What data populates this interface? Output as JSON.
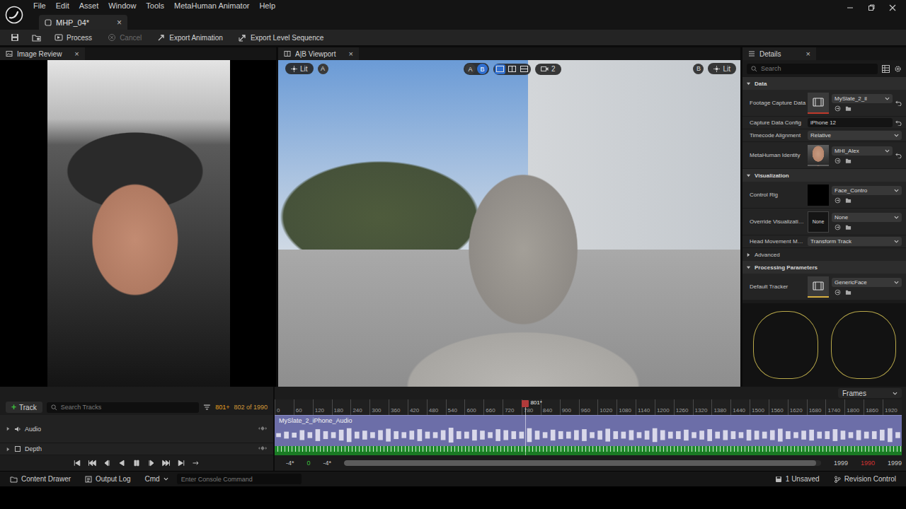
{
  "window": {
    "document_tab": "MHP_04*",
    "tab_close": "×"
  },
  "menu": [
    "File",
    "Edit",
    "Asset",
    "Window",
    "Tools",
    "MetaHuman Animator",
    "Help"
  ],
  "toolbar": [
    {
      "label": "Process",
      "disabled": false
    },
    {
      "label": "Cancel",
      "disabled": true
    },
    {
      "label": "Export Animation",
      "disabled": false
    },
    {
      "label": "Export Level Sequence",
      "disabled": false
    }
  ],
  "image_review": {
    "title": "Image Review",
    "close": "×"
  },
  "viewport": {
    "title": "A|B Viewport",
    "close": "×",
    "left_lit": "Lit",
    "left_view": "A",
    "ab_toggle": [
      {
        "label": "A",
        "selected": false
      },
      {
        "label": "B",
        "selected": true
      }
    ],
    "layouts": [
      {
        "selected": true
      },
      {
        "selected": false
      },
      {
        "selected": false
      }
    ],
    "camera_count": "2",
    "right_view": "B",
    "right_lit": "Lit"
  },
  "details": {
    "title": "Details",
    "close": "×",
    "search_placeholder": "Search",
    "sections": [
      {
        "title": "Data",
        "expanded": true,
        "rows": [
          {
            "label": "Footage Capture Data",
            "kind": "asset",
            "value": "MySlate_2_il",
            "reset": true
          },
          {
            "label": "Capture Data Config",
            "kind": "text",
            "value": "iPhone 12",
            "reset": true
          },
          {
            "label": "Timecode Alignment",
            "kind": "dropdown",
            "value": "Relative",
            "reset": false
          },
          {
            "label": "MetaHuman Identity",
            "kind": "asset",
            "value": "MHI_Alex",
            "reset": true
          }
        ]
      },
      {
        "title": "Visualization",
        "expanded": true,
        "rows": [
          {
            "label": "Control Rig",
            "kind": "asset",
            "value": "Face_Contro",
            "reset": false
          },
          {
            "label": "Override Visualizati…",
            "kind": "asset",
            "value": "None",
            "thumb_text": "None",
            "reset": false
          },
          {
            "label": "Head Movement M…",
            "kind": "dropdown",
            "value": "Transform Track",
            "reset": false
          }
        ]
      },
      {
        "title": "Advanced",
        "expanded": false,
        "rows": []
      },
      {
        "title": "Processing Parameters",
        "expanded": true,
        "rows": [
          {
            "label": "Default Tracker",
            "kind": "asset",
            "value": "GenericFace",
            "reset": false
          }
        ]
      }
    ]
  },
  "sequencer": {
    "add_icon": "+",
    "add_label": "Track",
    "search_placeholder": "Search Tracks",
    "current_frame": "801+",
    "frame_count": "802 of 1990",
    "time_units": "Frames",
    "ruler": [
      "0",
      "60",
      "120",
      "180",
      "240",
      "300",
      "360",
      "420",
      "480",
      "540",
      "600",
      "660",
      "720",
      "780",
      "840",
      "900",
      "960",
      "1020",
      "1080",
      "1140",
      "1200",
      "1260",
      "1320",
      "1380",
      "1440",
      "1500",
      "1560",
      "1620",
      "1680",
      "1740",
      "1800",
      "1860",
      "1920"
    ],
    "playhead": {
      "label": "801*",
      "level": 0.4
    },
    "tracks": [
      {
        "name": "Audio",
        "expanded": false
      },
      {
        "name": "Depth",
        "expanded": false
      }
    ],
    "audio_clip": {
      "name": "MySlate_2_iPhone_Audio",
      "waveform": [
        0.2,
        0.35,
        0.25,
        0.5,
        0.3,
        0.6,
        0.4,
        0.3,
        0.55,
        0.7,
        0.35,
        0.45,
        0.3,
        0.5,
        0.65,
        0.4,
        0.3,
        0.45,
        0.6,
        0.35,
        0.3,
        0.5,
        0.75,
        0.4,
        0.35,
        0.55,
        0.45,
        0.3,
        0.6,
        0.5,
        0.4,
        0.35,
        0.7,
        0.45,
        0.3,
        0.55,
        0.4,
        0.35,
        0.5,
        0.6,
        0.3,
        0.45,
        0.65,
        0.4,
        0.35,
        0.5,
        0.3,
        0.45,
        0.7,
        0.5,
        0.35,
        0.4,
        0.55,
        0.3,
        0.45,
        0.6,
        0.35,
        0.5,
        0.4,
        0.3,
        0.55,
        0.45,
        0.35,
        0.5,
        0.65,
        0.4,
        0.3,
        0.45,
        0.55,
        0.35,
        0.4,
        0.6,
        0.45,
        0.3,
        0.5,
        0.35,
        0.4,
        0.55,
        0.7,
        0.3
      ]
    },
    "range_start": [
      {
        "label": "-4*",
        "color": "#c8c8c8"
      },
      {
        "label": "0",
        "color": "#3cc13c"
      },
      {
        "label": "-4*",
        "color": "#c8c8c8"
      }
    ],
    "scroll": {
      "level": 0.99
    },
    "range_end": [
      {
        "label": "1999",
        "color": "#c8c8c8"
      },
      {
        "label": "1990",
        "color": "#d23232"
      },
      {
        "label": "1999",
        "color": "#c8c8c8"
      }
    ]
  },
  "status_bar": {
    "left": [
      "Content Drawer",
      "Output Log",
      "Cmd"
    ],
    "console_placeholder": "Enter Console Command",
    "unsaved": "1 Unsaved",
    "revision": "Revision Control"
  }
}
